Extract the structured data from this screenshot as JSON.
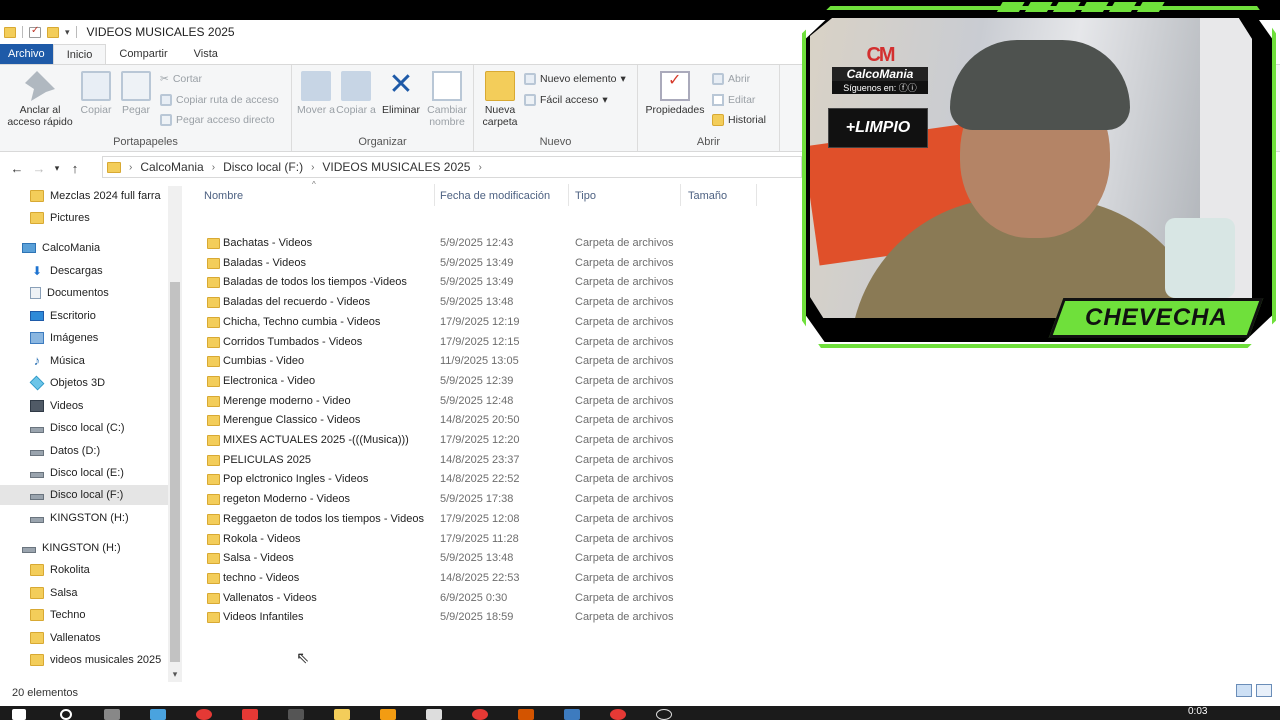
{
  "window": {
    "title": "VIDEOS MUSICALES 2025"
  },
  "tabs": [
    "Archivo",
    "Inicio",
    "Compartir",
    "Vista"
  ],
  "ribbon": {
    "portapapeles": {
      "label": "Portapapeles",
      "anclar": "Anclar al acceso rápido",
      "copiar": "Copiar",
      "pegar": "Pegar",
      "cortar": "Cortar",
      "copiar_ruta": "Copiar ruta de acceso",
      "pegar_acceso": "Pegar acceso directo"
    },
    "organizar": {
      "label": "Organizar",
      "mover": "Mover a",
      "copiar_a": "Copiar a",
      "eliminar": "Eliminar",
      "cambiar_nombre": "Cambiar nombre"
    },
    "nuevo": {
      "label": "Nuevo",
      "nueva_carpeta": "Nueva carpeta",
      "nuevo_elemento": "Nuevo elemento",
      "facil_acceso": "Fácil acceso"
    },
    "abrir": {
      "label": "Abrir",
      "propiedades": "Propiedades",
      "abrir": "Abrir",
      "editar": "Editar",
      "historial": "Historial"
    }
  },
  "address": {
    "crumbs": [
      "CalcoMania",
      "Disco local (F:)",
      "VIDEOS MUSICALES 2025"
    ]
  },
  "navpane": [
    {
      "label": "Mezclas 2024 full farra",
      "icon": "folder"
    },
    {
      "label": "Pictures",
      "icon": "folder"
    },
    {
      "label": "CalcoMania",
      "icon": "pc"
    },
    {
      "label": "Descargas",
      "icon": "download"
    },
    {
      "label": "Documentos",
      "icon": "doc"
    },
    {
      "label": "Escritorio",
      "icon": "desktop"
    },
    {
      "label": "Imágenes",
      "icon": "image"
    },
    {
      "label": "Música",
      "icon": "music"
    },
    {
      "label": "Objetos 3D",
      "icon": "3d"
    },
    {
      "label": "Videos",
      "icon": "video"
    },
    {
      "label": "Disco local (C:)",
      "icon": "drive"
    },
    {
      "label": "Datos (D:)",
      "icon": "drive"
    },
    {
      "label": "Disco local (E:)",
      "icon": "drive"
    },
    {
      "label": "Disco local (F:)",
      "icon": "drive"
    },
    {
      "label": "KINGSTON (H:)",
      "icon": "drive"
    },
    {
      "label": "KINGSTON (H:)",
      "icon": "drive"
    },
    {
      "label": "Rokolita",
      "icon": "folder"
    },
    {
      "label": "Salsa",
      "icon": "folder"
    },
    {
      "label": "Techno",
      "icon": "folder"
    },
    {
      "label": "Vallenatos",
      "icon": "folder"
    },
    {
      "label": "videos musicales 2025",
      "icon": "folder"
    }
  ],
  "columns": {
    "nombre": "Nombre",
    "fecha": "Fecha de modificación",
    "tipo": "Tipo",
    "tamano": "Tamaño"
  },
  "files": [
    {
      "name": "Bachatas - Videos",
      "date": "5/9/2025 12:43",
      "type": "Carpeta de archivos"
    },
    {
      "name": "Baladas - Videos",
      "date": "5/9/2025 13:49",
      "type": "Carpeta de archivos"
    },
    {
      "name": "Baladas de todos los tiempos -Videos",
      "date": "5/9/2025 13:49",
      "type": "Carpeta de archivos"
    },
    {
      "name": "Baladas del recuerdo - Videos",
      "date": "5/9/2025 13:48",
      "type": "Carpeta de archivos"
    },
    {
      "name": "Chicha, Techno cumbia - Videos",
      "date": "17/9/2025 12:19",
      "type": "Carpeta de archivos"
    },
    {
      "name": "Corridos Tumbados - Videos",
      "date": "17/9/2025 12:15",
      "type": "Carpeta de archivos"
    },
    {
      "name": "Cumbias - Video",
      "date": "11/9/2025 13:05",
      "type": "Carpeta de archivos"
    },
    {
      "name": "Electronica - Video",
      "date": "5/9/2025 12:39",
      "type": "Carpeta de archivos"
    },
    {
      "name": "Merenge moderno - Video",
      "date": "5/9/2025 12:48",
      "type": "Carpeta de archivos"
    },
    {
      "name": "Merengue  Classico - Videos",
      "date": "14/8/2025 20:50",
      "type": "Carpeta de archivos"
    },
    {
      "name": "MIXES ACTUALES 2025 -(((Musica)))",
      "date": "17/9/2025 12:20",
      "type": "Carpeta de archivos"
    },
    {
      "name": "PELICULAS 2025",
      "date": "14/8/2025 23:37",
      "type": "Carpeta de archivos"
    },
    {
      "name": "Pop elctronico Ingles - Videos",
      "date": "14/8/2025 22:52",
      "type": "Carpeta de archivos"
    },
    {
      "name": "regeton Moderno - Videos",
      "date": "5/9/2025 17:38",
      "type": "Carpeta de archivos"
    },
    {
      "name": "Reggaeton de todos los tiempos - Videos",
      "date": "17/9/2025 12:08",
      "type": "Carpeta de archivos"
    },
    {
      "name": "Rokola - Videos",
      "date": "17/9/2025 11:28",
      "type": "Carpeta de archivos"
    },
    {
      "name": "Salsa - Videos",
      "date": "5/9/2025 13:48",
      "type": "Carpeta de archivos"
    },
    {
      "name": "techno - Videos",
      "date": "14/8/2025 22:53",
      "type": "Carpeta de archivos"
    },
    {
      "name": "Vallenatos - Videos",
      "date": "6/9/2025 0:30",
      "type": "Carpeta de archivos"
    },
    {
      "name": "Videos Infantiles",
      "date": "5/9/2025 18:59",
      "type": "Carpeta de archivos"
    }
  ],
  "status": {
    "count": "20 elementos"
  },
  "overlay": {
    "logo_brand": "CalcoMania",
    "logo_follow": "Síguenos en:",
    "badge": "+LIMPIO",
    "streamer": "CHEVECHA"
  },
  "taskbar": {
    "time": "0:03"
  },
  "colors": {
    "accent": "#1e5aa8",
    "folder": "#f3cd5a",
    "overlay_green": "#6fe03b"
  }
}
